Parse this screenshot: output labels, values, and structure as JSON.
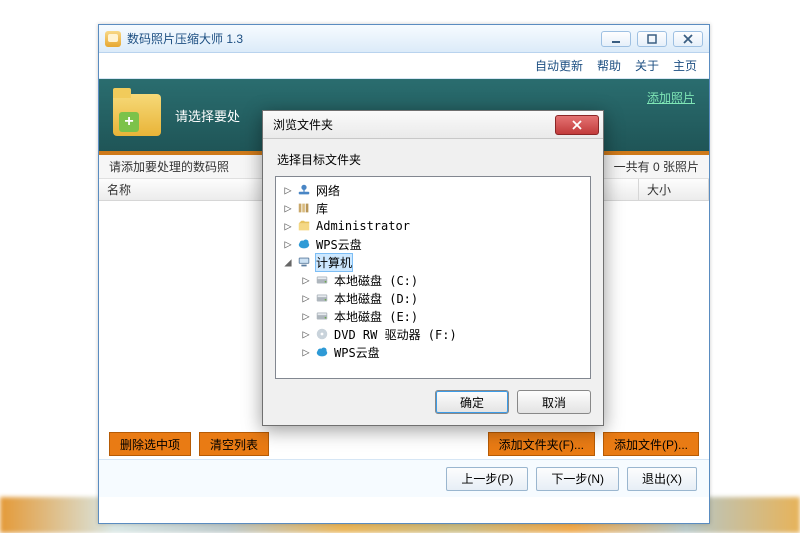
{
  "app": {
    "title": "数码照片压缩大师 1.3"
  },
  "menu": {
    "auto_update": "自动更新",
    "help": "帮助",
    "about": "关于",
    "home": "主页"
  },
  "banner": {
    "hint": "请选择要处",
    "add_photo": "添加照片"
  },
  "status": {
    "left": "请添加要处理的数码照",
    "right_prefix": "一共有",
    "right_count": "0",
    "right_suffix": "张照片"
  },
  "columns": {
    "name": "名称",
    "size": "大小"
  },
  "actions": {
    "delete_selected": "删除选中项",
    "clear_list": "清空列表",
    "add_folder": "添加文件夹(F)...",
    "add_file": "添加文件(P)..."
  },
  "nav": {
    "prev": "上一步(P)",
    "next": "下一步(N)",
    "exit": "退出(X)"
  },
  "dialog": {
    "title": "浏览文件夹",
    "instruction": "选择目标文件夹",
    "ok": "确定",
    "cancel": "取消",
    "tree": [
      {
        "label": "网络",
        "icon": "network",
        "indent": 0,
        "exp": "▷"
      },
      {
        "label": "库",
        "icon": "lib",
        "indent": 0,
        "exp": "▷"
      },
      {
        "label": "Administrator",
        "icon": "user",
        "indent": 0,
        "exp": "▷"
      },
      {
        "label": "WPS云盘",
        "icon": "cloud",
        "indent": 0,
        "exp": "▷"
      },
      {
        "label": "计算机",
        "icon": "pc",
        "indent": 0,
        "exp": "◢",
        "selected": true
      },
      {
        "label": "本地磁盘 (C:)",
        "icon": "disk",
        "indent": 1,
        "exp": "▷"
      },
      {
        "label": "本地磁盘 (D:)",
        "icon": "disk",
        "indent": 1,
        "exp": "▷"
      },
      {
        "label": "本地磁盘 (E:)",
        "icon": "disk",
        "indent": 1,
        "exp": "▷"
      },
      {
        "label": "DVD RW 驱动器 (F:)",
        "icon": "dvd",
        "indent": 1,
        "exp": "▷"
      },
      {
        "label": "WPS云盘",
        "icon": "cloud",
        "indent": 1,
        "exp": "▷"
      }
    ]
  }
}
